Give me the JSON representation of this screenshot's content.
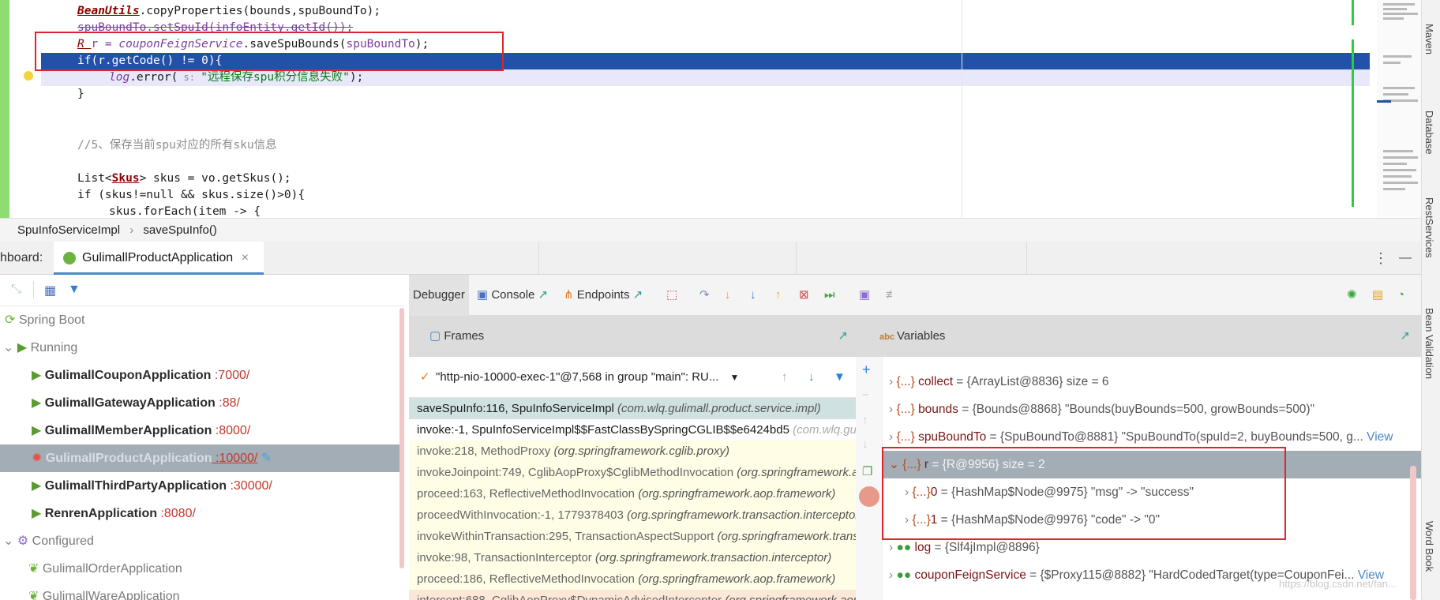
{
  "editor": {
    "lines": {
      "l1_a": "BeanUtils",
      "l1_b": ".copyProperties(bounds,spuBoundTo);",
      "l2": "spuBoundTo.setSpuId(infoEntity.getId());",
      "l3_a": "R ",
      "l3_b": "r = ",
      "l3_c": "couponFeignService",
      "l3_d": ".saveSpuBounds(",
      "l3_e": "spuBoundTo",
      "l3_f": ");",
      "l4": "if(r.getCode() != 0){",
      "l5_a": "log",
      "l5_b": ".error(",
      "l5_c": " s: ",
      "l5_d": "\"远程保存spu积分信息失败\"",
      "l5_e": ");",
      "l6": "}",
      "l7": "//5、保存当前spu对应的所有sku信息",
      "l8_a": "List<",
      "l8_b": "Skus",
      "l8_c": "> skus = vo.getSkus();",
      "l9": "if (skus!=null && skus.size()>0){",
      "l10": "skus.forEach(item -> {"
    }
  },
  "breadcrumb": {
    "class": "SpuInfoServiceImpl",
    "sep": "›",
    "method": "saveSpuInfo()"
  },
  "dashboard": {
    "label": "hboard:",
    "tab": "GulimallProductApplication",
    "close": "×",
    "more": "⋮",
    "minimize": "—"
  },
  "services": {
    "root": "Spring Boot",
    "running": "Running",
    "apps": [
      {
        "name": "GulimallCouponApplication",
        "port": " :7000/"
      },
      {
        "name": "GulimallGatewayApplication",
        "port": " :88/"
      },
      {
        "name": "GulimallMemberApplication",
        "port": " :8000/"
      },
      {
        "name": "GulimallProductApplication",
        "port": " :10000/"
      },
      {
        "name": "GulimallThirdPartyApplication",
        "port": " :30000/"
      },
      {
        "name": "RenrenApplication",
        "port": " :8080/"
      }
    ],
    "configured": "Configured",
    "configured_apps": [
      "GulimallOrderApplication",
      "GulimallWareApplication"
    ]
  },
  "debugger": {
    "tabs": {
      "debugger": "Debugger",
      "console": "Console",
      "endpoints": "Endpoints"
    },
    "frames_title": "Frames",
    "variables_title": "Variables",
    "thread": "\"http-nio-10000-exec-1\"@7,568 in group \"main\": RU...",
    "frames": [
      {
        "method": "saveSpuInfo:116, SpuInfoServiceImpl ",
        "pkg": "(com.wlq.gulimall.product.service.impl)"
      },
      {
        "method": "invoke:-1, SpuInfoServiceImpl$$FastClassBySpringCGLIB$$e6424bd5 ",
        "pkg": "(com.wlq.gulimall.product)"
      },
      {
        "method": "invoke:218, MethodProxy ",
        "pkg": "(org.springframework.cglib.proxy)"
      },
      {
        "method": "invokeJoinpoint:749, CglibAopProxy$CglibMethodInvocation ",
        "pkg": "(org.springframework.aop)"
      },
      {
        "method": "proceed:163, ReflectiveMethodInvocation ",
        "pkg": "(org.springframework.aop.framework)"
      },
      {
        "method": "proceedWithInvocation:-1, 1779378403 ",
        "pkg": "(org.springframework.transaction.interceptor)"
      },
      {
        "method": "invokeWithinTransaction:295, TransactionAspectSupport ",
        "pkg": "(org.springframework.transaction)"
      },
      {
        "method": "invoke:98, TransactionInterceptor ",
        "pkg": "(org.springframework.transaction.interceptor)"
      },
      {
        "method": "proceed:186, ReflectiveMethodInvocation ",
        "pkg": "(org.springframework.aop.framework)"
      },
      {
        "method": "intercept:688, CglibAopProxy$DynamicAdvisedInterceptor ",
        "pkg": "(org.springframework.aop)"
      }
    ],
    "variables": [
      {
        "name": "collect",
        "val": " = {ArrayList@8836}  size = 6"
      },
      {
        "name": "bounds",
        "val": " = {Bounds@8868} \"Bounds(buyBounds=500, growBounds=500)\""
      },
      {
        "name": "spuBoundTo",
        "val": " = {SpuBoundTo@8881} \"SpuBoundTo(spuId=2, buyBounds=500, g...",
        "link": "View"
      },
      {
        "name": "r",
        "val": " = {R@9956}  size = 2"
      },
      {
        "name": "0",
        "val": " = {HashMap$Node@9975} \"msg\" -> \"success\""
      },
      {
        "name": "1",
        "val": " = {HashMap$Node@9976} \"code\" -> \"0\""
      },
      {
        "name": "log",
        "val": " = {Slf4jImpl@8896}"
      },
      {
        "name": "couponFeignService",
        "val": " = {$Proxy115@8882} \"HardCodedTarget(type=CouponFei...",
        "link": "View"
      }
    ],
    "obj_prefix": "{...}"
  },
  "right_strip": [
    "Maven",
    "Database",
    "RestServices",
    "Bean Validation",
    "Word Book"
  ],
  "watermark": "https://blog.csdn.net/fan..."
}
